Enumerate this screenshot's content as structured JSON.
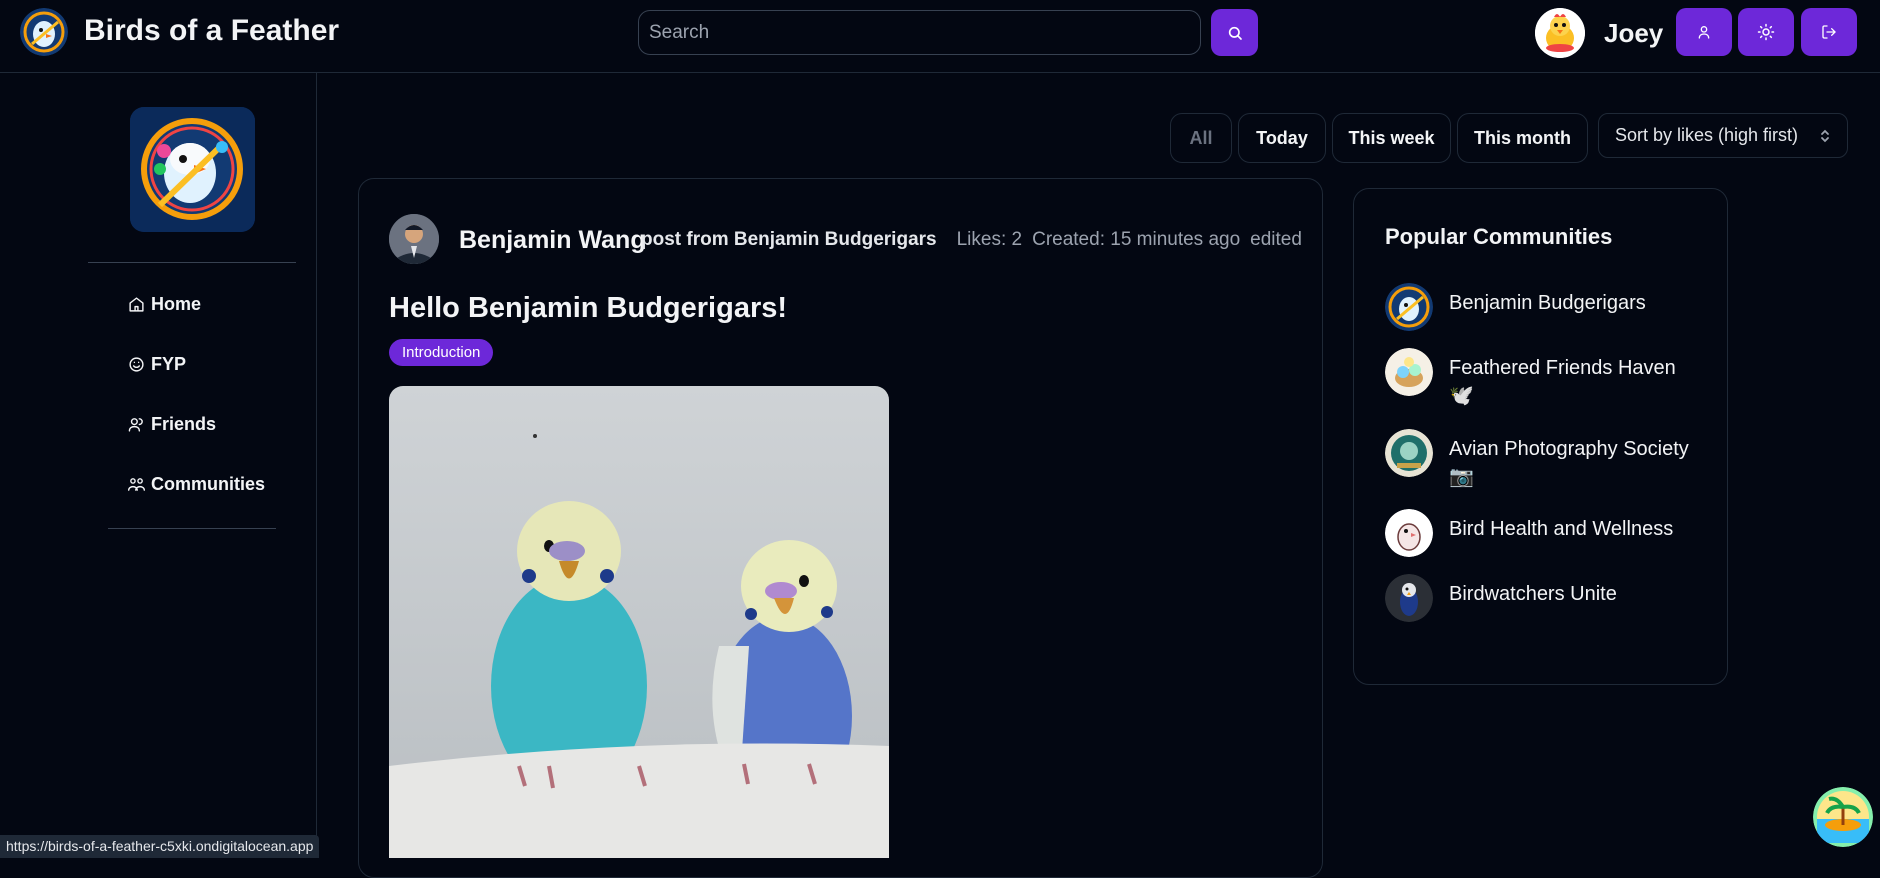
{
  "header": {
    "brand": "Birds of a Feather",
    "search_placeholder": "Search",
    "username": "Joey"
  },
  "sidebar": {
    "items": [
      {
        "label": "Home",
        "icon": "home-icon"
      },
      {
        "label": "FYP",
        "icon": "smile-icon"
      },
      {
        "label": "Friends",
        "icon": "user-icon"
      },
      {
        "label": "Communities",
        "icon": "users-icon"
      }
    ]
  },
  "filters": {
    "items": [
      "All",
      "Today",
      "This week",
      "This month"
    ],
    "sort_selected": "Sort by likes (high first)"
  },
  "post": {
    "author": "Benjamin Wang",
    "from": "post from Benjamin Budgerigars",
    "likes": "Likes: 2",
    "created": "Created: 15 minutes ago",
    "edited": "edited",
    "title": "Hello Benjamin Budgerigars!",
    "tag": "Introduction"
  },
  "popular": {
    "title": "Popular Communities",
    "communities": [
      {
        "name": "Benjamin Budgerigars"
      },
      {
        "name": "Feathered Friends Haven 🕊️"
      },
      {
        "name": "Avian Photography Society 📷"
      },
      {
        "name": "Bird Health and Wellness"
      },
      {
        "name": "Birdwatchers Unite"
      }
    ]
  },
  "status_bar": {
    "url": "https://birds-of-a-feather-c5xki.ondigitalocean.app"
  },
  "colors": {
    "background": "#030712",
    "accent": "#6d28d9",
    "border": "#1f2937"
  }
}
